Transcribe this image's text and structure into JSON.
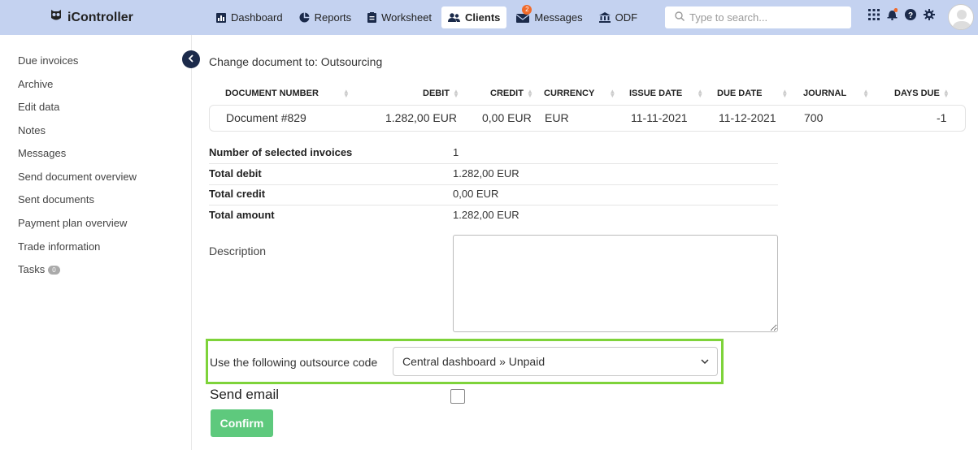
{
  "app": {
    "name": "iController"
  },
  "nav": [
    {
      "label": "Dashboard",
      "icon": "chart-icon"
    },
    {
      "label": "Reports",
      "icon": "pie-chart-icon"
    },
    {
      "label": "Worksheet",
      "icon": "clipboard-icon"
    },
    {
      "label": "Clients",
      "icon": "users-icon",
      "active": true
    },
    {
      "label": "Messages",
      "icon": "envelope-icon",
      "badge": "2"
    },
    {
      "label": "ODF",
      "icon": "bank-icon"
    }
  ],
  "search": {
    "placeholder": "Type to search..."
  },
  "sidebar": {
    "items": [
      {
        "label": "Due invoices"
      },
      {
        "label": "Archive"
      },
      {
        "label": "Edit data"
      },
      {
        "label": "Notes"
      },
      {
        "label": "Messages"
      },
      {
        "label": "Send document overview"
      },
      {
        "label": "Sent documents"
      },
      {
        "label": "Payment plan overview"
      },
      {
        "label": "Trade information"
      },
      {
        "label": "Tasks",
        "badge": "0"
      }
    ]
  },
  "main": {
    "title": "Change document to: Outsourcing",
    "table": {
      "headers": [
        "DOCUMENT NUMBER",
        "DEBIT",
        "CREDIT",
        "CURRENCY",
        "ISSUE DATE",
        "DUE DATE",
        "JOURNAL",
        "DAYS DUE"
      ],
      "row": [
        "Document #829",
        "1.282,00 EUR",
        "0,00 EUR",
        "EUR",
        "11-11-2021",
        "11-12-2021",
        "700",
        "-1"
      ]
    },
    "summary": [
      {
        "label": "Number of selected invoices",
        "value": "1"
      },
      {
        "label": "Total debit",
        "value": "1.282,00 EUR"
      },
      {
        "label": "Total credit",
        "value": "0,00 EUR"
      },
      {
        "label": "Total amount",
        "value": "1.282,00 EUR"
      }
    ],
    "description_label": "Description",
    "description_value": "",
    "outsource_label": "Use the following outsource code",
    "outsource_value": "Central dashboard » Unpaid",
    "send_email_label": "Send email",
    "confirm_label": "Confirm"
  },
  "colors": {
    "topbar": "#c4d2f0",
    "highlight": "#7ed33a",
    "confirm": "#5ec97d",
    "badge": "#f06a2a"
  }
}
